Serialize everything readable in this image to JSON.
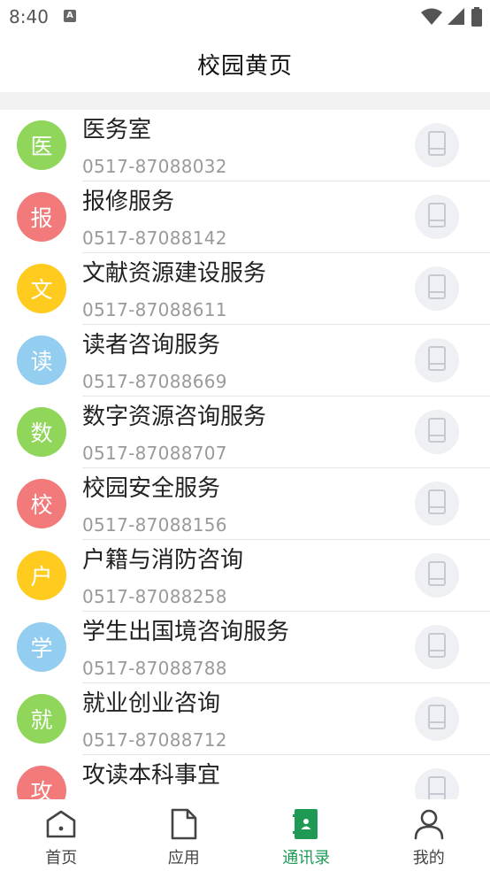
{
  "status_bar": {
    "time": "8:40",
    "notification_icon": "a-icon"
  },
  "header": {
    "title": "校园黄页"
  },
  "colors": {
    "green": "#8fd65a",
    "red": "#f37a7a",
    "yellow": "#fecb1e",
    "blue": "#93cdf0",
    "accent": "#1f9a55"
  },
  "contacts": [
    {
      "initial": "医",
      "name": "医务室",
      "phone": "0517-87088032",
      "color": "#8fd65a"
    },
    {
      "initial": "报",
      "name": "报修服务",
      "phone": "0517-87088142",
      "color": "#f37a7a"
    },
    {
      "initial": "文",
      "name": "文献资源建设服务",
      "phone": "0517-87088611",
      "color": "#fecb1e"
    },
    {
      "initial": "读",
      "name": "读者咨询服务",
      "phone": "0517-87088669",
      "color": "#93cdf0"
    },
    {
      "initial": "数",
      "name": "数字资源咨询服务",
      "phone": "0517-87088707",
      "color": "#8fd65a"
    },
    {
      "initial": "校",
      "name": "校园安全服务",
      "phone": "0517-87088156",
      "color": "#f37a7a"
    },
    {
      "initial": "户",
      "name": "户籍与消防咨询",
      "phone": "0517-87088258",
      "color": "#fecb1e"
    },
    {
      "initial": "学",
      "name": "学生出国境咨询服务",
      "phone": "0517-87088788",
      "color": "#93cdf0"
    },
    {
      "initial": "就",
      "name": "就业创业咨询",
      "phone": "0517-87088712",
      "color": "#8fd65a"
    },
    {
      "initial": "攻",
      "name": "攻读本科事宜",
      "phone": "",
      "color": "#f37a7a"
    }
  ],
  "tabbar": [
    {
      "label": "首页",
      "icon": "home-icon",
      "active": false
    },
    {
      "label": "应用",
      "icon": "document-icon",
      "active": false
    },
    {
      "label": "通讯录",
      "icon": "contacts-book-icon",
      "active": true
    },
    {
      "label": "我的",
      "icon": "person-icon",
      "active": false
    }
  ]
}
